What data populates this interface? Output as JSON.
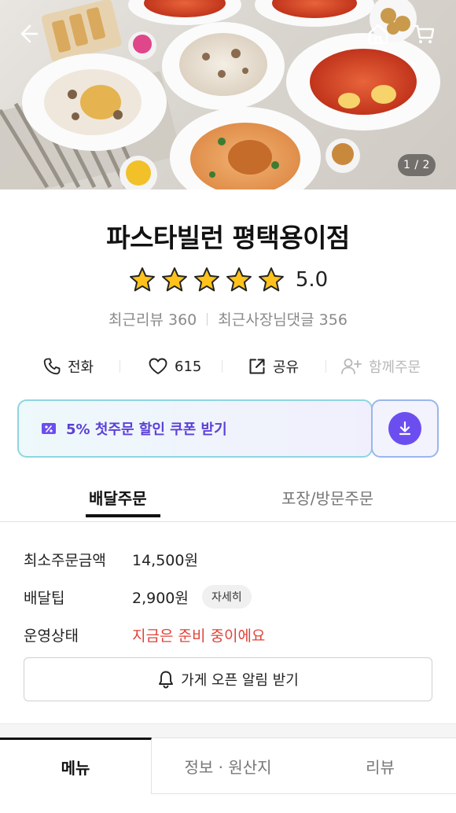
{
  "header": {
    "back_icon": "arrow-left-icon",
    "home_icon": "home-icon",
    "cart_icon": "cart-icon",
    "image_pager": "1 / 2"
  },
  "store": {
    "name": "파스타빌런 평택용이점",
    "rating": "5.0",
    "stars": 5,
    "recent_reviews": "최근리뷰 360",
    "owner_replies": "최근사장님댓글 356"
  },
  "actions": {
    "call_label": "전화",
    "like_count": "615",
    "share_label": "공유",
    "group_order_label": "함께주문"
  },
  "coupon": {
    "label": "5% 첫주문 할인 쿠폰 받기",
    "accent_color": "#6c4ef0"
  },
  "order_tabs": [
    {
      "label": "배달주문",
      "active": true
    },
    {
      "label": "포장/방문주문",
      "active": false
    }
  ],
  "info": {
    "min_order_label": "최소주문금액",
    "min_order_value": "14,500원",
    "delivery_tip_label": "배달팁",
    "delivery_tip_value": "2,900원",
    "detail_label": "자세히",
    "status_label": "운영상태",
    "status_value": "지금은 준비 중이에요",
    "status_color": "#e0433a"
  },
  "notify_button_label": "가게 오픈 알림 받기",
  "bottom_tabs": [
    {
      "label": "메뉴",
      "active": true
    },
    {
      "label": "정보 · 원산지",
      "active": false
    },
    {
      "label": "리뷰",
      "active": false
    }
  ]
}
